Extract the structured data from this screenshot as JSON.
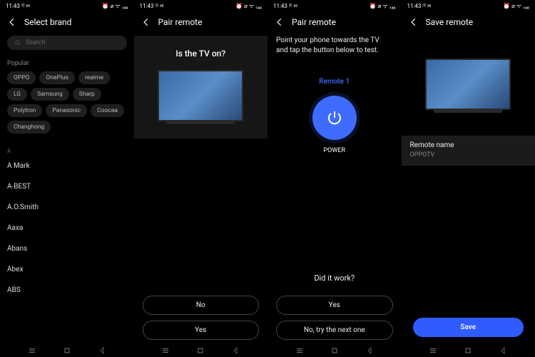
{
  "status": {
    "time": "11:43",
    "icons_left_brief": "⌾ ⋈",
    "icons_right_brief": "⏰ ⌀ ᯤ ₁₄₀"
  },
  "screen1": {
    "title": "Select brand",
    "search_placeholder": "Search",
    "popular_label": "Popular",
    "popular_brands": [
      "OPPO",
      "OnePlus",
      "realme",
      "LG",
      "Samsung",
      "Sharp",
      "Polytron",
      "Panasonic",
      "Coocaa",
      "Changhong"
    ],
    "group_a_label": "A",
    "group_a": [
      "A Mark",
      "A-BEST",
      "A.O.Smith",
      "Aaxa",
      "Abans",
      "Abex",
      "ABS"
    ]
  },
  "screen2": {
    "title": "Pair remote",
    "prompt": "Is the TV on?",
    "no": "No",
    "yes": "Yes"
  },
  "screen3": {
    "title": "Pair remote",
    "instructions": "Point your phone towards the TV and tap the button below to test.",
    "remote_label": "Remote 1",
    "power_label": "POWER",
    "did_it_work": "Did it work?",
    "yes": "Yes",
    "no_next": "No, try the next one"
  },
  "screen4": {
    "title": "Save remote",
    "name_label": "Remote name",
    "name_value": "OPPOTV",
    "save": "Save"
  }
}
